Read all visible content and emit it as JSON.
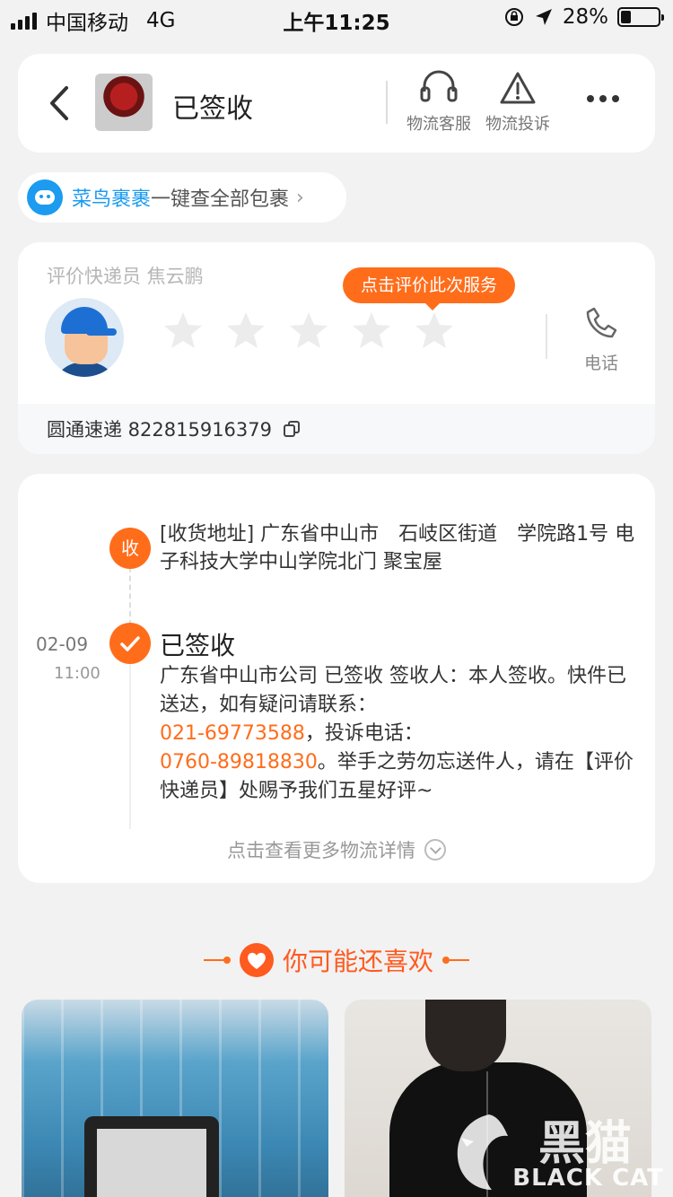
{
  "status_bar": {
    "carrier": "中国移动",
    "network": "4G",
    "time": "上午11:25",
    "battery": "28%",
    "battery_level": 0.28
  },
  "header": {
    "title": "已签收",
    "actions": [
      {
        "label": "物流客服",
        "icon": "headset-icon"
      },
      {
        "label": "物流投诉",
        "icon": "warning-icon"
      }
    ]
  },
  "cainiao": {
    "brand": "菜鸟裹裹",
    "text": "一键查全部包裹"
  },
  "courier": {
    "label": "评价快递员 焦云鹏",
    "rate_tip": "点击评价此次服务",
    "rating": 0,
    "max_rating": 5,
    "phone_label": "电话",
    "tracking": "圆通速递 822815916379"
  },
  "timeline": {
    "receive_badge": "收",
    "address": "[收货地址] 广东省中山市　石岐区街道　学院路1号  电子科技大学中山学院北门  聚宝屋",
    "date": "02-09",
    "time": "11:00",
    "signed_title": "已签收",
    "desc_1": "广东省中山市公司 已签收 签收人：本人签收。快件已送达，如有疑问请联系：",
    "phone_1": "021-69773588",
    "desc_2": "，投诉电话：",
    "phone_2": "0760-89818830",
    "desc_3": "。举手之劳勿忘送件人，请在【评价快递员】处赐予我们五星好评~",
    "more_link": "点击查看更多物流详情"
  },
  "recommend": {
    "title": "你可能还喜欢"
  },
  "watermark": {
    "big": "黑猫",
    "small": "BLACK CAT"
  },
  "colors": {
    "accent": "#ff6d1b",
    "brand_blue": "#1c9bf0"
  }
}
